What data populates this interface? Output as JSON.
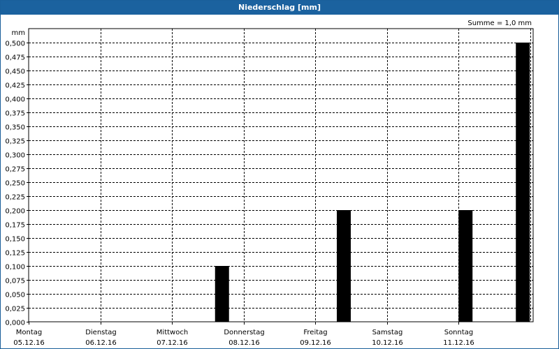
{
  "window": {
    "title": "Niederschlag [mm]"
  },
  "chart_data": {
    "type": "bar",
    "title": "Niederschlag [mm]",
    "ylabel": "mm",
    "annotation": "Summe = 1,0 mm",
    "ylim": [
      0,
      0.5
    ],
    "y_ticks": [
      "0,000",
      "0,025",
      "0,050",
      "0,075",
      "0,100",
      "0,125",
      "0,150",
      "0,175",
      "0,200",
      "0,225",
      "0,250",
      "0,275",
      "0,300",
      "0,325",
      "0,350",
      "0,375",
      "0,400",
      "0,425",
      "0,450",
      "0,475",
      "0,500"
    ],
    "day_labels": [
      {
        "day": "Montag",
        "date": "05.12.16"
      },
      {
        "day": "Dienstag",
        "date": "06.12.16"
      },
      {
        "day": "Mittwoch",
        "date": "07.12.16"
      },
      {
        "day": "Donnerstag",
        "date": "08.12.16"
      },
      {
        "day": "Freitag",
        "date": "09.12.16"
      },
      {
        "day": "Samstag",
        "date": "10.12.16"
      },
      {
        "day": "Sonntag",
        "date": "11.12.16"
      }
    ],
    "bars": [
      {
        "day_offset": 2.7,
        "value": 0.1
      },
      {
        "day_offset": 4.4,
        "value": 0.2
      },
      {
        "day_offset": 6.1,
        "value": 0.2
      },
      {
        "day_offset": 6.9,
        "value": 0.5
      }
    ],
    "bar_color": "#000000",
    "grid": true,
    "grid_style": "dashed"
  }
}
